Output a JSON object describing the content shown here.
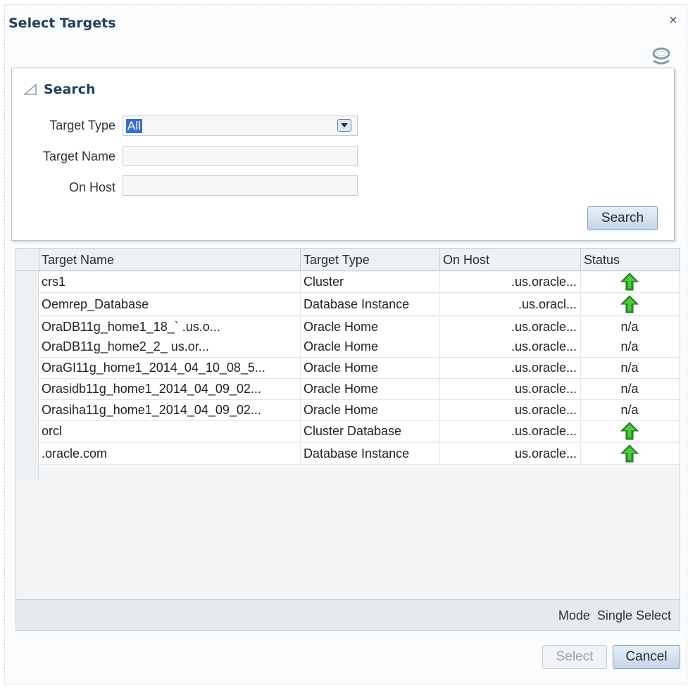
{
  "dialog": {
    "title": "Select Targets",
    "close_glyph": "×",
    "help_icon": "oracle-help-icon"
  },
  "search": {
    "header": "Search",
    "target_type_label": "Target Type",
    "target_type_value": "All",
    "target_name_label": "Target Name",
    "target_name_value": "",
    "on_host_label": "On Host",
    "on_host_value": "",
    "search_button": "Search"
  },
  "table": {
    "columns": [
      "Target Name",
      "Target Type",
      "On Host",
      "Status"
    ],
    "rows": [
      {
        "name": "crs1",
        "type": "Cluster",
        "host": ".us.oracle...",
        "status": "up-arrow-icon",
        "status_text": ""
      },
      {
        "name": "Oemrep_Database",
        "type": "Database Instance",
        "host": ".us.oracl...",
        "status": "up-arrow-icon",
        "status_text": ""
      },
      {
        "name": "OraDB11g_home1_18_`              .us.o...",
        "type": "Oracle Home",
        "host": ".us.oracle...",
        "status": "",
        "status_text": "n/a"
      },
      {
        "name": "OraDB11g_home2_2_               us.or...",
        "type": "Oracle Home",
        "host": ".us.oracle...",
        "status": "",
        "status_text": "n/a"
      },
      {
        "name": "OraGI11g_home1_2014_04_10_08_5...",
        "type": "Oracle Home",
        "host": ".us.oracle...",
        "status": "",
        "status_text": "n/a"
      },
      {
        "name": "Orasidb11g_home1_2014_04_09_02...",
        "type": "Oracle Home",
        "host": "us.oracle...",
        "status": "",
        "status_text": "n/a"
      },
      {
        "name": "Orasiha11g_home1_2014_04_09_02...",
        "type": "Oracle Home",
        "host": "us.oracle...",
        "status": "",
        "status_text": "n/a"
      },
      {
        "name": "orcl",
        "type": "Cluster Database",
        "host": ".us.oracle...",
        "status": "up-arrow-icon",
        "status_text": ""
      },
      {
        "name": "           .oracle.com",
        "type": "Database Instance",
        "host": "us.oracle...",
        "status": "up-arrow-icon",
        "status_text": ""
      }
    ],
    "mode_label": "Mode",
    "mode_value": "Single Select"
  },
  "actions": {
    "select_label": "Select",
    "cancel_label": "Cancel"
  },
  "colors": {
    "title": "#23415f",
    "up_arrow": "#2f9e24",
    "selection": "#3a6fc8"
  }
}
